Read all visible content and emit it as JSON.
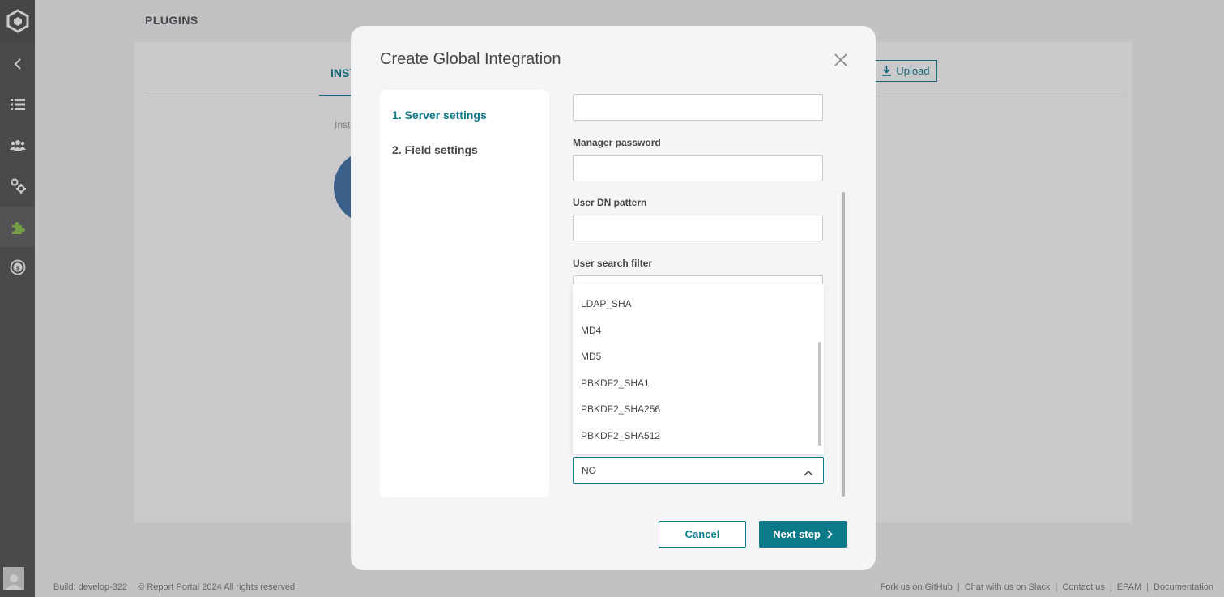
{
  "page": {
    "title": "PLUGINS",
    "tab_installed": "INST",
    "installed_text": "Insta",
    "upload_label": "Upload"
  },
  "footer": {
    "build": "Build: develop-322",
    "copyright": "© Report Portal 2024 All rights reserved",
    "links": [
      "Fork us on GitHub",
      "Chat with us on Slack",
      "Contact us",
      "EPAM",
      "Documentation"
    ]
  },
  "modal": {
    "title": "Create Global Integration",
    "steps": [
      "1. Server settings",
      "2. Field settings"
    ],
    "labels": {
      "manager_password": "Manager password",
      "user_dn_pattern": "User DN pattern",
      "user_search_filter": "User search filter"
    },
    "dropdown_options": [
      "LDAP_SHA",
      "MD4",
      "MD5",
      "PBKDF2_SHA1",
      "PBKDF2_SHA256",
      "PBKDF2_SHA512"
    ],
    "select_value": "NO",
    "cancel_label": "Cancel",
    "next_label": "Next step"
  },
  "colors": {
    "accent": "#0b7a8b",
    "sidebar": "#505050"
  },
  "icons": {
    "sidebar": [
      "logo-icon",
      "back-icon",
      "launches-icon",
      "members-icon",
      "settings-icon",
      "plugins-icon",
      "billing-icon"
    ]
  }
}
